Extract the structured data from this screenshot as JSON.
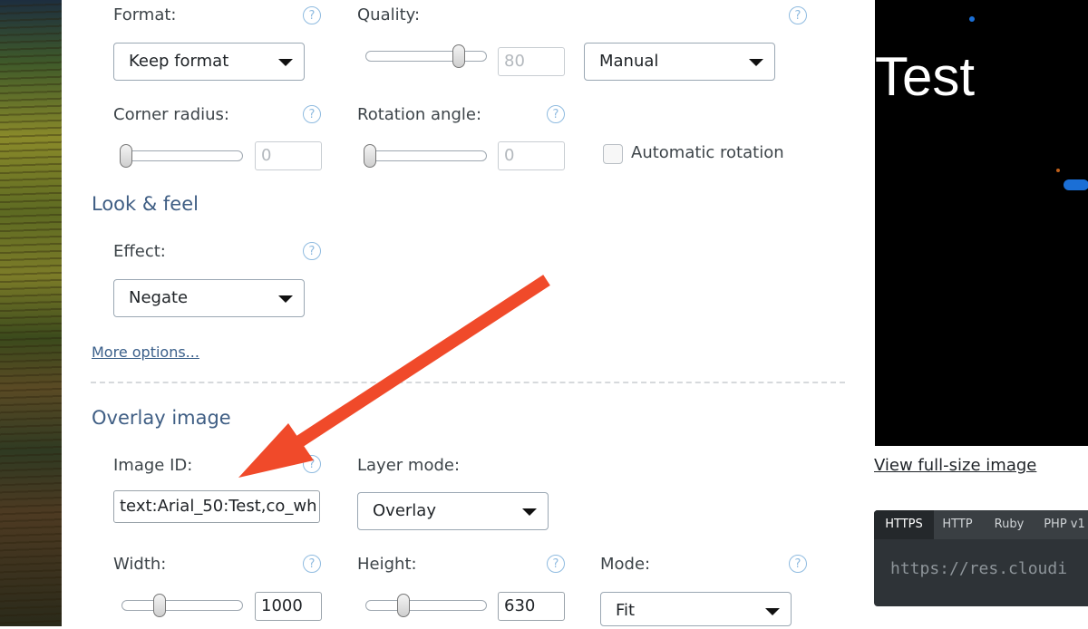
{
  "fields": {
    "format_label": "Format:",
    "quality_label": "Quality:",
    "corner_label": "Corner radius:",
    "rotation_label": "Rotation angle:",
    "effect_label": "Effect:",
    "image_id_label": "Image ID:",
    "layer_mode_label": "Layer mode:",
    "width_label": "Width:",
    "height_label": "Height:",
    "mode_label": "Mode:"
  },
  "values": {
    "format": "Keep format",
    "quality": "80",
    "quality_mode": "Manual",
    "corner_radius": "0",
    "rotation_angle": "0",
    "automatic_rotation": "Automatic rotation",
    "effect": "Negate",
    "image_id": "text:Arial_50:Test,co_wh",
    "layer_mode": "Overlay",
    "width": "1000",
    "height": "630",
    "mode": "Fit"
  },
  "sliders": {
    "quality": 0.8,
    "corner_radius": 0,
    "rotation_angle": 0,
    "width": 0.3,
    "height": 0.3
  },
  "sections": {
    "look_feel": "Look & feel",
    "overlay_image": "Overlay image"
  },
  "links": {
    "more_options": "More options...",
    "view_full": "View full-size image"
  },
  "help_glyph": "?",
  "preview": {
    "text": "Test",
    "dot_color": "#1b6fd6"
  },
  "code_tabs": [
    "HTTPS",
    "HTTP",
    "Ruby",
    "PHP v1"
  ],
  "code_url": "https://res.cloudi",
  "annotation_arrow_color": "#f04a2a"
}
